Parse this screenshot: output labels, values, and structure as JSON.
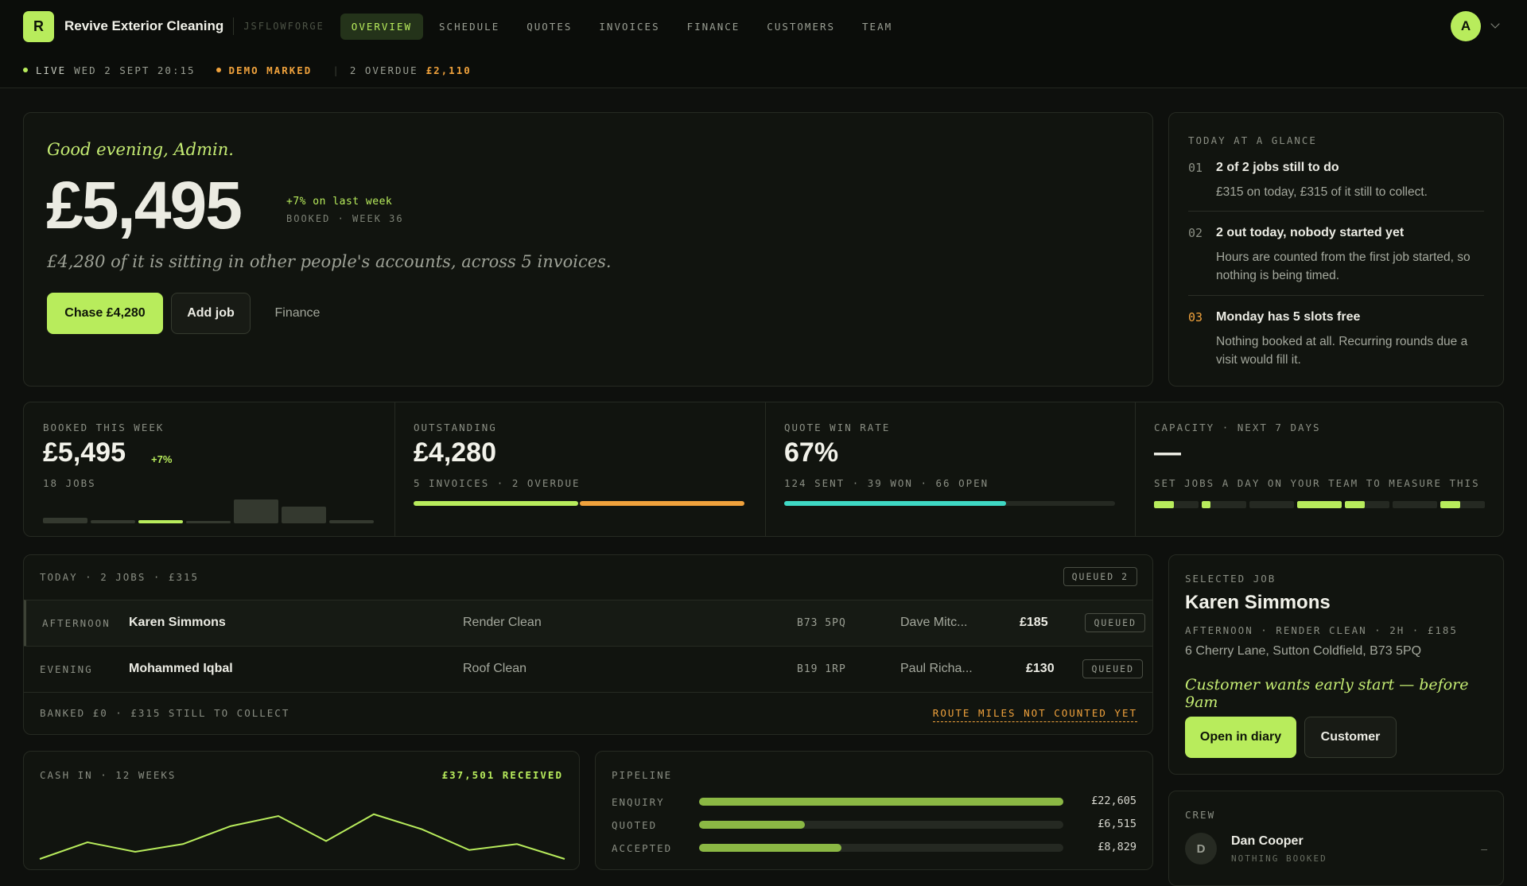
{
  "nav": {
    "logo_letter": "R",
    "brand": "Revive Exterior Cleaning",
    "org": "JSFLOWFORGE",
    "tabs": [
      {
        "label": "OVERVIEW",
        "active": true
      },
      {
        "label": "SCHEDULE"
      },
      {
        "label": "QUOTES"
      },
      {
        "label": "INVOICES"
      },
      {
        "label": "FINANCE"
      },
      {
        "label": "CUSTOMERS"
      },
      {
        "label": "TEAM"
      }
    ],
    "avatar_letter": "A"
  },
  "status": {
    "live_label": "LIVE",
    "datetime": "WED 2 SEPT 20:15",
    "demo_label": "DEMO MARKED",
    "overdue_label": "2 OVERDUE",
    "overdue_amount": "£2,110"
  },
  "hero": {
    "greeting": "Good evening, Admin.",
    "amount": "£5,495",
    "delta": "+7% on last week",
    "week": "BOOKED · WEEK 36",
    "sitting": "£4,280 of it is sitting in other people's accounts, across 5 invoices.",
    "chase_label": "Chase £4,280",
    "add_job_label": "Add job",
    "finance_label": "Finance"
  },
  "glance": {
    "title": "TODAY AT A GLANCE",
    "items": [
      {
        "num": "01",
        "title": "2 of 2 jobs still to do",
        "desc": "£315 on today, £315 of it still to collect."
      },
      {
        "num": "02",
        "title": "2 out today, nobody started yet",
        "desc": "Hours are counted from the first job started, so nothing is being timed."
      },
      {
        "num": "03",
        "title": "Monday has 5 slots free",
        "desc": "Nothing booked at all. Recurring rounds due a visit would fill it."
      }
    ]
  },
  "kpis": {
    "booked": {
      "label": "BOOKED THIS WEEK",
      "value": "£5,495",
      "delta": "+7%",
      "sub": "18 JOBS",
      "bars": [
        0.25,
        0.12,
        0.12,
        0.05,
        1.0,
        0.7,
        0.15
      ],
      "bar_highlight": 2
    },
    "outstanding": {
      "label": "OUTSTANDING",
      "value": "£4,280",
      "sub": "5 INVOICES · 2 OVERDUE",
      "split": [
        0.5,
        0.5
      ]
    },
    "winrate": {
      "label": "QUOTE WIN RATE",
      "value": "67%",
      "sub": "124 SENT · 39 WON · 66 OPEN",
      "fill": 0.67
    },
    "capacity": {
      "label": "CAPACITY · NEXT 7 DAYS",
      "value": "—",
      "sub": "SET JOBS A DAY ON YOUR TEAM TO MEASURE THIS",
      "days": [
        0.45,
        0.2,
        0.0,
        1.0,
        0.45,
        0.0,
        0.45
      ]
    }
  },
  "today": {
    "header": "TODAY · 2 JOBS · £315",
    "queued_pill": "QUEUED 2",
    "rows": [
      {
        "slot": "AFTERNOON",
        "name": "Karen Simmons",
        "service": "Render Clean",
        "postcode": "B73 5PQ",
        "crew": "Dave Mitc...",
        "amount": "£185",
        "status": "QUEUED"
      },
      {
        "slot": "EVENING",
        "name": "Mohammed Iqbal",
        "service": "Roof Clean",
        "postcode": "B19 1RP",
        "crew": "Paul Richa...",
        "amount": "£130",
        "status": "QUEUED"
      }
    ],
    "footer": "BANKED £0 · £315 STILL TO COLLECT",
    "route": "ROUTE MILES NOT COUNTED YET"
  },
  "selected_job": {
    "label": "SELECTED JOB",
    "name": "Karen Simmons",
    "meta": "AFTERNOON · RENDER CLEAN · 2H · £185",
    "address": "6 Cherry Lane, Sutton Coldfield, B73 5PQ",
    "note": "Customer wants early start — before 9am",
    "open_label": "Open in diary",
    "customer_label": "Customer"
  },
  "cash": {
    "label": "CASH IN · 12 WEEKS",
    "received": "£37,501 RECEIVED",
    "points": [
      0.0,
      0.28,
      0.12,
      0.25,
      0.55,
      0.72,
      0.3,
      0.75,
      0.5,
      0.15,
      0.25,
      0.0
    ]
  },
  "pipeline": {
    "label": "PIPELINE",
    "stages": [
      {
        "name": "ENQUIRY",
        "value": "£22,605",
        "fill": 1.0
      },
      {
        "name": "QUOTED",
        "value": "£6,515",
        "fill": 0.29
      },
      {
        "name": "ACCEPTED",
        "value": "£8,829",
        "fill": 0.39
      }
    ]
  },
  "crew": {
    "label": "CREW",
    "members": [
      {
        "initial": "D",
        "name": "Dan Cooper",
        "status": "NOTHING BOOKED",
        "trail": "–"
      }
    ]
  },
  "colors": {
    "accent": "#b8ec5c",
    "warn": "#f0a23c",
    "teal": "#3fd8c4",
    "bg": "#0e100d"
  }
}
